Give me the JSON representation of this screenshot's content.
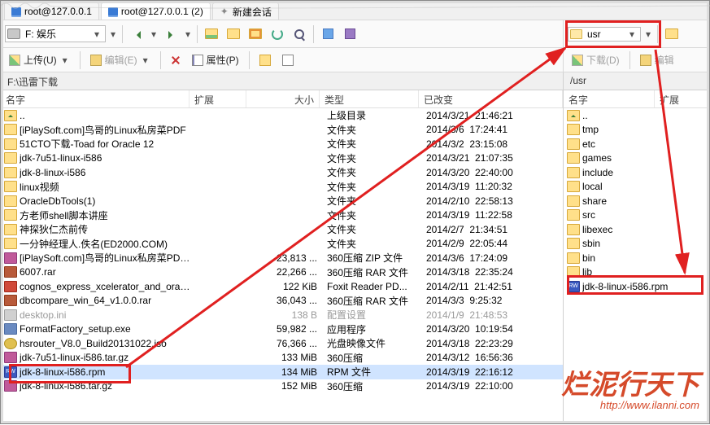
{
  "tabs": [
    {
      "label": "root@127.0.0.1"
    },
    {
      "label": "root@127.0.0.1 (2)"
    },
    {
      "label": "新建会话"
    }
  ],
  "leftDrive": "F: 娱乐",
  "rightDrive": "usr",
  "actions": {
    "upload": "上传(U)",
    "editL": "编辑(E)",
    "propL": "属性(P)",
    "download": "下载(D)",
    "editR": "编辑"
  },
  "leftPath": "F:\\迅雷下载",
  "rightPath": "/usr",
  "cols": {
    "name": "名字",
    "ext": "扩展",
    "size": "大小",
    "type": "类型",
    "changed": "已改变"
  },
  "leftRows": [
    {
      "ic": "up",
      "name": "..",
      "size": "",
      "type": "上级目录",
      "date": "2014/3/21",
      "time": "21:46:21"
    },
    {
      "ic": "fld",
      "name": "[iPlaySoft.com]鸟哥的Linux私房菜PDF",
      "size": "",
      "type": "文件夹",
      "date": "2014/3/6",
      "time": "17:24:41"
    },
    {
      "ic": "fld",
      "name": "51CTO下载-Toad for Oracle 12",
      "size": "",
      "type": "文件夹",
      "date": "2014/3/2",
      "time": "23:15:08"
    },
    {
      "ic": "fld",
      "name": "jdk-7u51-linux-i586",
      "size": "",
      "type": "文件夹",
      "date": "2014/3/21",
      "time": "21:07:35"
    },
    {
      "ic": "fld",
      "name": "jdk-8-linux-i586",
      "size": "",
      "type": "文件夹",
      "date": "2014/3/20",
      "time": "22:40:00"
    },
    {
      "ic": "fld",
      "name": "linux视频",
      "size": "",
      "type": "文件夹",
      "date": "2014/3/19",
      "time": "11:20:32"
    },
    {
      "ic": "fld",
      "name": "OracleDbTools(1)",
      "size": "",
      "type": "文件夹",
      "date": "2014/2/10",
      "time": "22:58:13"
    },
    {
      "ic": "fld",
      "name": "方老师shell脚本讲座",
      "size": "",
      "type": "文件夹",
      "date": "2014/3/19",
      "time": "11:22:58"
    },
    {
      "ic": "fld",
      "name": "神探狄仁杰前传",
      "size": "",
      "type": "文件夹",
      "date": "2014/2/7",
      "time": "21:34:51"
    },
    {
      "ic": "fld",
      "name": "一分钟经理人.佚名(ED2000.COM)",
      "size": "",
      "type": "文件夹",
      "date": "2014/2/9",
      "time": "22:05:44"
    },
    {
      "ic": "zip",
      "name": "[iPlaySoft.com]鸟哥的Linux私房菜PDF.zip",
      "size": "23,813 ...",
      "type": "360压缩 ZIP 文件",
      "date": "2014/3/6",
      "time": "17:24:09"
    },
    {
      "ic": "rar",
      "name": "6007.rar",
      "size": "22,266 ...",
      "type": "360压缩 RAR 文件",
      "date": "2014/3/18",
      "time": "22:35:24"
    },
    {
      "ic": "pdf",
      "name": "cognos_express_xcelerator_and_oracle_odbc.pdf",
      "size": "122 KiB",
      "type": "Foxit Reader PD...",
      "date": "2014/2/11",
      "time": "21:42:51"
    },
    {
      "ic": "rar",
      "name": "dbcompare_win_64_v1.0.0.rar",
      "size": "36,043 ...",
      "type": "360压缩 RAR 文件",
      "date": "2014/3/3",
      "time": "9:25:32"
    },
    {
      "ic": "ini",
      "name": "desktop.ini",
      "size": "138 B",
      "type": "配置设置",
      "date": "2014/1/9",
      "time": "21:48:53",
      "dim": true
    },
    {
      "ic": "exe",
      "name": "FormatFactory_setup.exe",
      "size": "59,982 ...",
      "type": "应用程序",
      "date": "2014/3/20",
      "time": "10:19:54"
    },
    {
      "ic": "iso",
      "name": "hsrouter_V8.0_Build20131022.iso",
      "size": "76,366 ...",
      "type": "光盘映像文件",
      "date": "2014/3/18",
      "time": "22:23:29"
    },
    {
      "ic": "gz",
      "name": "jdk-7u51-linux-i586.tar.gz",
      "size": "133 MiB",
      "type": "360压缩",
      "date": "2014/3/12",
      "time": "16:56:36"
    },
    {
      "ic": "rpm",
      "name": "jdk-8-linux-i586.rpm",
      "size": "134 MiB",
      "type": "RPM 文件",
      "date": "2014/3/19",
      "time": "22:16:12",
      "sel": true
    },
    {
      "ic": "gz",
      "name": "jdk-8-linux-i586.tar.gz",
      "size": "152 MiB",
      "type": "360压缩",
      "date": "2014/3/19",
      "time": "22:10:00"
    }
  ],
  "rightRows": [
    {
      "ic": "up",
      "name": ".."
    },
    {
      "ic": "fld",
      "name": "tmp"
    },
    {
      "ic": "fld",
      "name": "etc"
    },
    {
      "ic": "fld",
      "name": "games"
    },
    {
      "ic": "fld",
      "name": "include"
    },
    {
      "ic": "fld",
      "name": "local"
    },
    {
      "ic": "fld",
      "name": "share"
    },
    {
      "ic": "fld",
      "name": "src"
    },
    {
      "ic": "fld",
      "name": "libexec"
    },
    {
      "ic": "fld",
      "name": "sbin"
    },
    {
      "ic": "fld",
      "name": "bin"
    },
    {
      "ic": "fld",
      "name": "lib"
    },
    {
      "ic": "rpm",
      "name": "jdk-8-linux-i586.rpm"
    }
  ],
  "watermark": {
    "text": "烂泥行天下",
    "url": "http://www.ilanni.com"
  }
}
